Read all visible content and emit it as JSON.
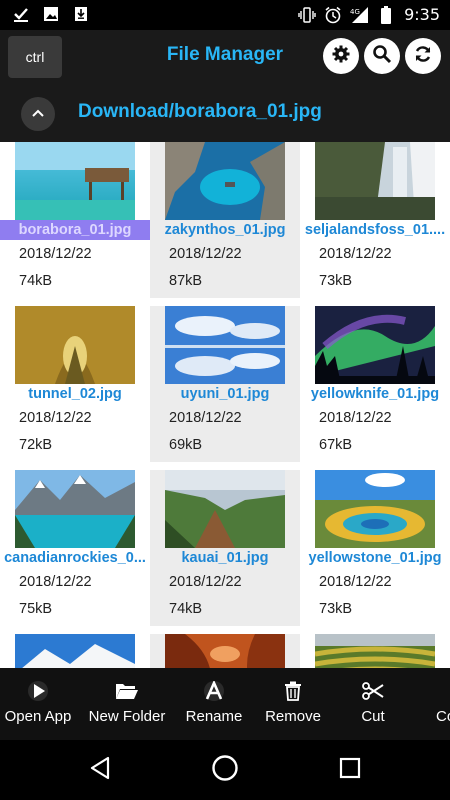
{
  "status_bar": {
    "time": "9:35",
    "left_icons": [
      "check-icon",
      "image-icon",
      "download-icon"
    ],
    "right_icons": [
      "vibrate-icon",
      "alarm-icon",
      "signal-4g-icon",
      "battery-icon"
    ],
    "network": "4G"
  },
  "app_bar": {
    "ctrl_label": "ctrl",
    "title": "File Manager",
    "actions": [
      "settings-icon",
      "search-icon",
      "refresh-icon"
    ]
  },
  "path_bar": {
    "path": "Download/borabora_01.jpg"
  },
  "files": [
    {
      "name": "borabora_01.jpg",
      "date": "2018/12/22",
      "size": "74kB",
      "selected": true
    },
    {
      "name": "zakynthos_01.jpg",
      "date": "2018/12/22",
      "size": "87kB"
    },
    {
      "name": "seljalandsfoss_01....",
      "date": "2018/12/22",
      "size": "73kB"
    },
    {
      "name": "tunnel_02.jpg",
      "date": "2018/12/22",
      "size": "72kB"
    },
    {
      "name": "uyuni_01.jpg",
      "date": "2018/12/22",
      "size": "69kB"
    },
    {
      "name": "yellowknife_01.jpg",
      "date": "2018/12/22",
      "size": "67kB"
    },
    {
      "name": "canadianrockies_0...",
      "date": "2018/12/22",
      "size": "75kB"
    },
    {
      "name": "kauai_01.jpg",
      "date": "2018/12/22",
      "size": "74kB"
    },
    {
      "name": "yellowstone_01.jpg",
      "date": "2018/12/22",
      "size": "73kB"
    },
    {
      "name": "",
      "date": "",
      "size": ""
    },
    {
      "name": "",
      "date": "",
      "size": ""
    },
    {
      "name": "",
      "date": "",
      "size": ""
    }
  ],
  "toolbar": {
    "items": [
      {
        "label": "Open App",
        "icon": "play-icon"
      },
      {
        "label": "New Folder",
        "icon": "folder-open-icon"
      },
      {
        "label": "Rename",
        "icon": "font-a-icon"
      },
      {
        "label": "Remove",
        "icon": "trash-icon"
      },
      {
        "label": "Cut",
        "icon": "scissors-icon"
      },
      {
        "label": "Co",
        "icon": "copy-icon"
      }
    ]
  },
  "nav_bar": {
    "buttons": [
      "back-icon",
      "home-icon",
      "recents-icon"
    ]
  },
  "colors": {
    "accent": "#29b6f6",
    "filename": "#1e88d6",
    "selected": "#8f7df0",
    "bar_bg": "#1a1a1a"
  }
}
